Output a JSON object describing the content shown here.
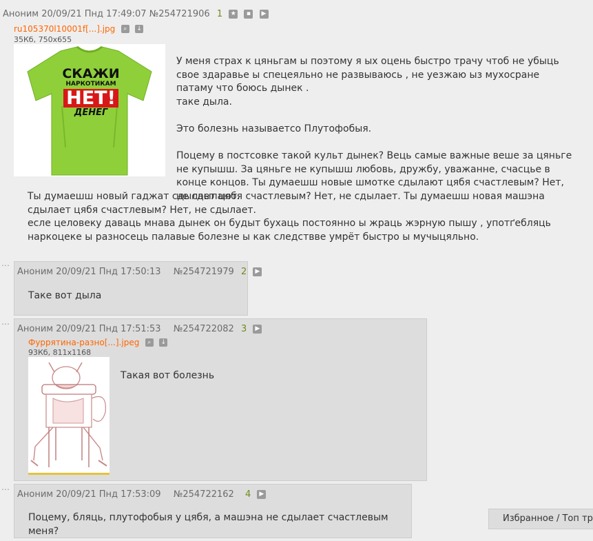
{
  "op": {
    "author": "Аноним",
    "date": "20/09/21 Пнд 17:49:07",
    "postnum": "№254721906",
    "index": "1",
    "file": {
      "name": "ru105370l10001f[...].jpg",
      "info": "35Кб, 750x655"
    },
    "shirt": {
      "line1": "СКАЖИ",
      "line2": "НАРКОТИКАМ",
      "line3": "НЕТ!",
      "line4": "ДЕНЕГ"
    },
    "paragraphs": [
      "У меня страх к цяньгам ы поэтому я ых оцень быстро трачу чтоб не убыць свое здаравье ы спецеяльно не развываюсь , не уезжаю ыз мухосране патаму что боюсь дынек .",
      "таке дыла.",
      "Это болезнь называетсо Плутофобыя.",
      "Поцему в постсовке такой культ дынек? Вець самые важные веше за цяньге не купышш. За цяньге не купышш любовь, дружбу, уважанне, счасцье в конце концов. Ты думаешш новые шмотке сдылают цябя счастлевым? Нет, не сдылают.",
      "Ты думаешш новый гаджат сдылает цябя счастлевым? Нет, не сдылает. Ты думаешш новая машэна сдылает цябя счастлевым? Нет, не сдылает.",
      "есле целовеку даваць мнава дынек он будыт бухаць постоянно ы жраць жэрную пышу , употґебляць наркоцеке ы разносець палавые болезне ы как следствве умрёт быстро ы мучыцяльно."
    ]
  },
  "replies": [
    {
      "author": "Аноним",
      "date": "20/09/21 Пнд 17:50:13",
      "postnum": "№254721979",
      "index": "2",
      "text": "Таке вот дыла"
    },
    {
      "author": "Аноним",
      "date": "20/09/21 Пнд 17:51:53",
      "postnum": "№254722082",
      "index": "3",
      "file": {
        "name": "Фуррятина-разно[...].jpeg",
        "info": "93Кб, 811x1168"
      },
      "text": "Такая вот болезнь"
    },
    {
      "author": "Аноним",
      "date": "20/09/21 Пнд 17:53:09",
      "postnum": "№254722162",
      "index": "4",
      "text": "Поцему, бляць, плутофобыя у цябя, а машэна не сдылает счастлевым меня?"
    }
  ],
  "footer": {
    "label": "Избранное / Топ тре"
  },
  "colors": {
    "filelink": "#ff6600",
    "index": "#6f8b20",
    "reply_bg": "#dddddd",
    "page_bg": "#eeeeee"
  },
  "icons": [
    "star-icon",
    "hide-icon",
    "play-icon",
    "search-icon",
    "download-icon",
    "dots-icon"
  ]
}
